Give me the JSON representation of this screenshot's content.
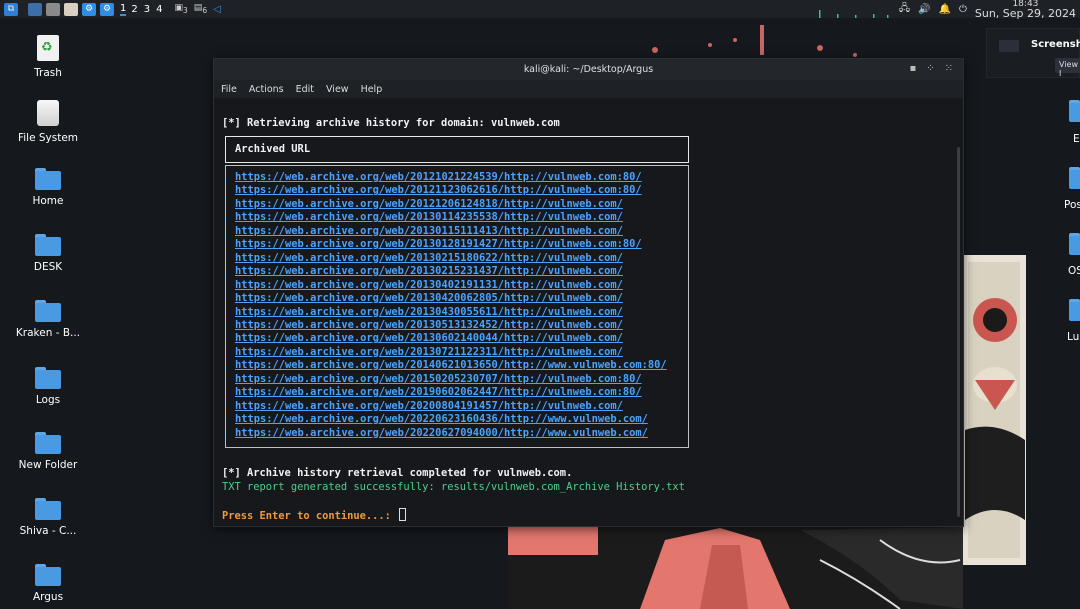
{
  "panel": {
    "workspaces": [
      "1",
      "2",
      "3",
      "4"
    ],
    "badge_a": "3",
    "badge_b": "6",
    "clock_time": "18:43",
    "clock_date": "Sun, Sep 29, 2024"
  },
  "desktop_icons": [
    "Trash",
    "File System",
    "Home",
    "DESK",
    "Kraken - B...",
    "Logs",
    "New Folder",
    "Shiva - C...",
    "Argus"
  ],
  "right_icons": [
    "E",
    "Pos",
    "OS",
    "Luc"
  ],
  "notification": {
    "title": "Screenshot",
    "button": "View I"
  },
  "terminal": {
    "title": "kali@kali: ~/Desktop/Argus",
    "menu": [
      "File",
      "Actions",
      "Edit",
      "View",
      "Help"
    ],
    "retrieving": "[*] Retrieving archive history for domain: vulnweb.com",
    "table_header": "Archived URL",
    "urls": [
      "https://web.archive.org/web/20121021224539/http://vulnweb.com:80/",
      "https://web.archive.org/web/20121123062616/http://vulnweb.com:80/",
      "https://web.archive.org/web/20121206124818/http://vulnweb.com/",
      "https://web.archive.org/web/20130114235538/http://vulnweb.com/",
      "https://web.archive.org/web/20130115111413/http://vulnweb.com/",
      "https://web.archive.org/web/20130128191427/http://vulnweb.com:80/",
      "https://web.archive.org/web/20130215180622/http://vulnweb.com/",
      "https://web.archive.org/web/20130215231437/http://vulnweb.com/",
      "https://web.archive.org/web/20130402191131/http://vulnweb.com/",
      "https://web.archive.org/web/20130420062805/http://vulnweb.com/",
      "https://web.archive.org/web/20130430055611/http://vulnweb.com/",
      "https://web.archive.org/web/20130513132452/http://vulnweb.com/",
      "https://web.archive.org/web/20130602140044/http://vulnweb.com/",
      "https://web.archive.org/web/20130721122311/http://vulnweb.com/",
      "https://web.archive.org/web/20140621013650/http://www.vulnweb.com:80/",
      "https://web.archive.org/web/20150205230707/http://vulnweb.com:80/",
      "https://web.archive.org/web/20190602062447/http://vulnweb.com:80/",
      "https://web.archive.org/web/20200804191457/http://vulnweb.com/",
      "https://web.archive.org/web/20220623160436/http://www.vulnweb.com/",
      "https://web.archive.org/web/20220627094000/http://www.vulnweb.com/"
    ],
    "completed": "[*] Archive history retrieval completed for vulnweb.com.",
    "report": "TXT report generated successfully: results/vulnweb.com_Archive History.txt",
    "prompt": "Press Enter to continue...: "
  },
  "colors": {
    "link": "#4aa3ff",
    "success": "#4fcf8a",
    "prompt": "#f09a3a"
  }
}
